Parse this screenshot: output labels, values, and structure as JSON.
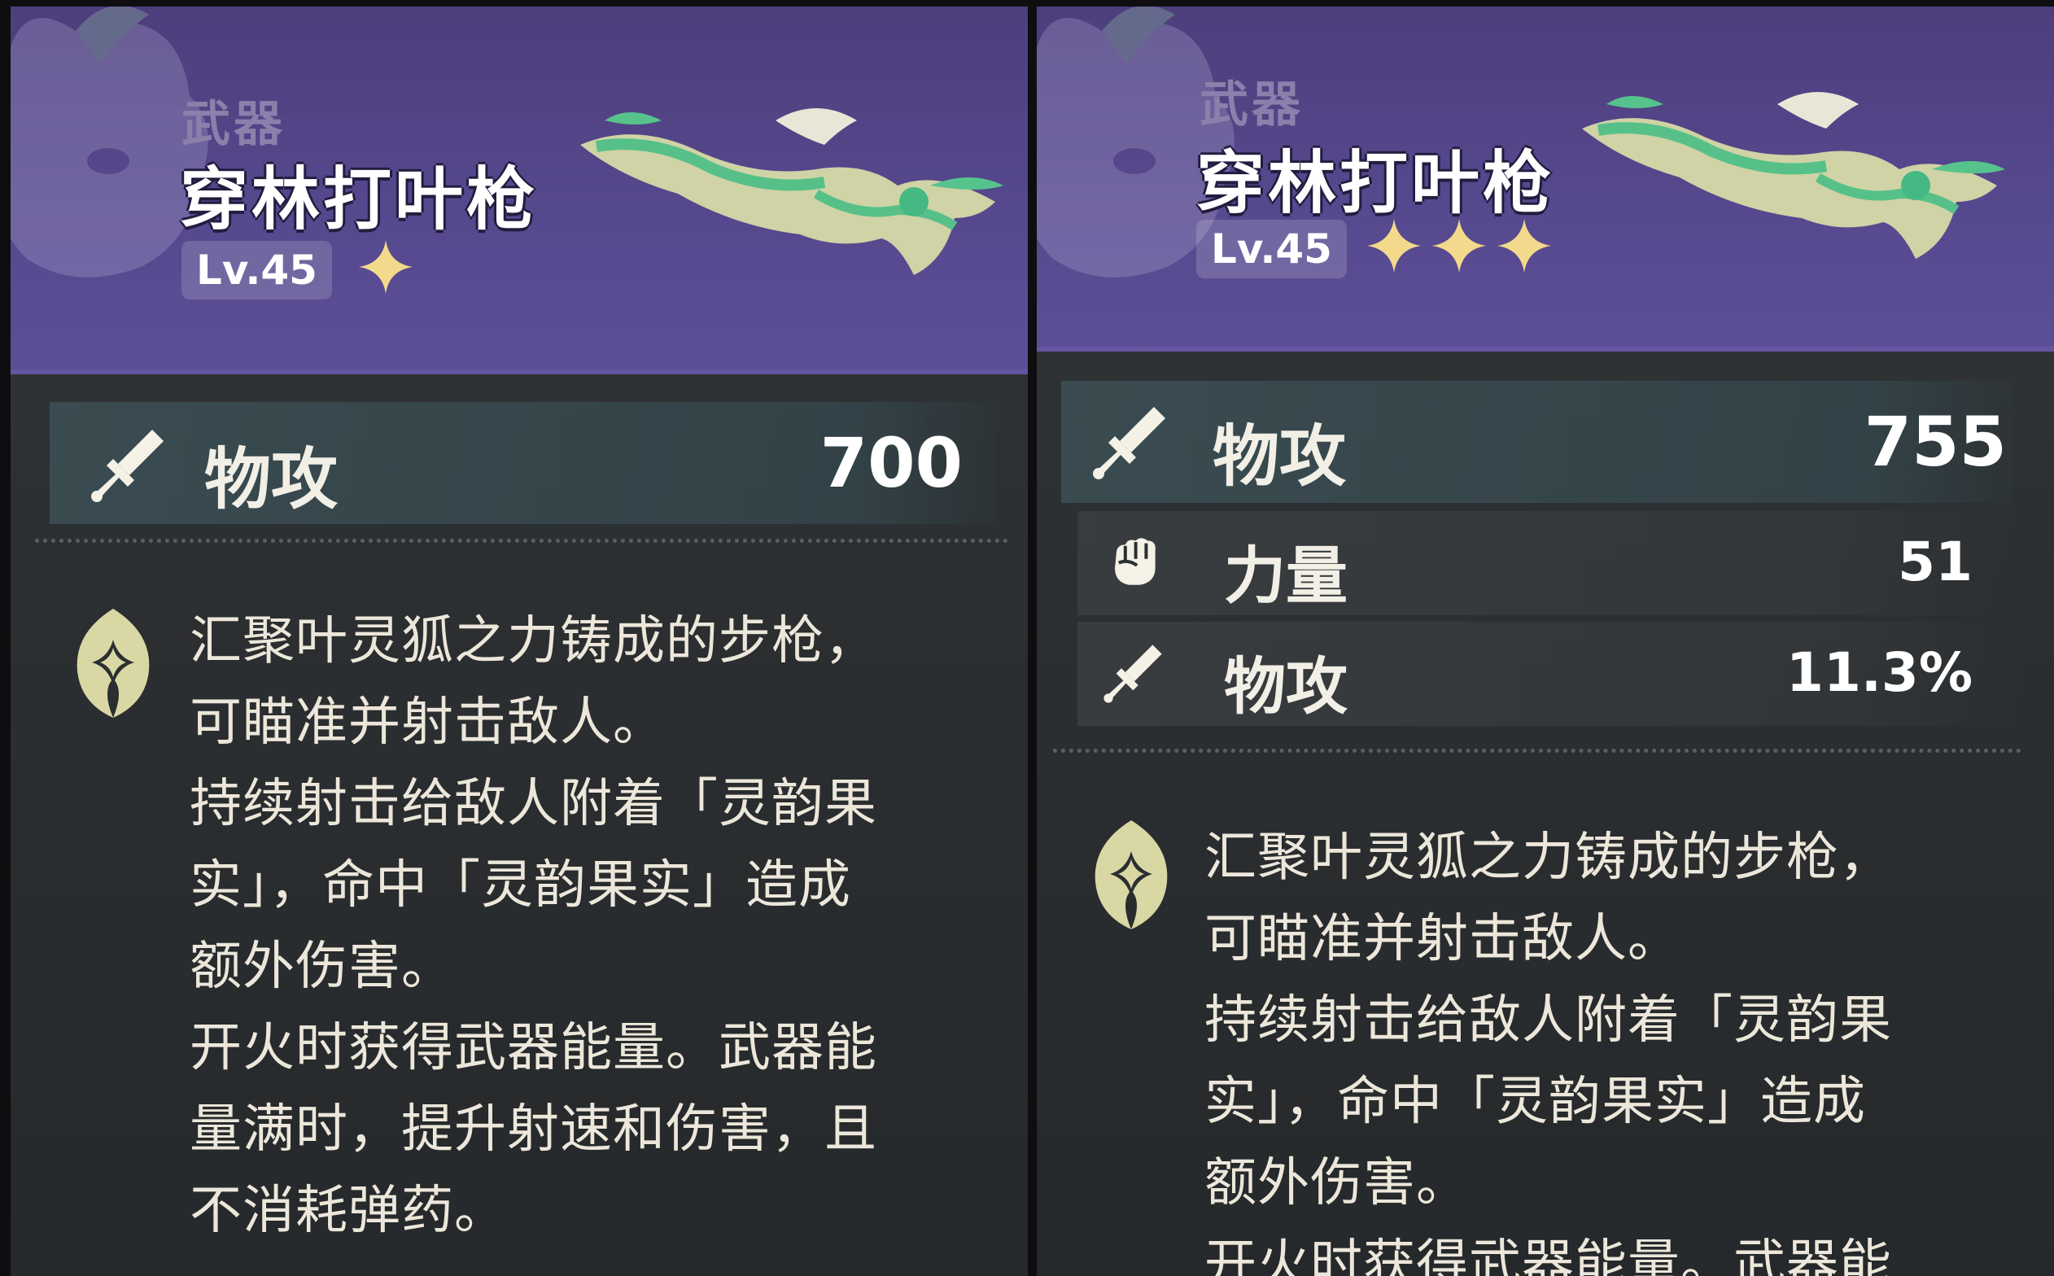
{
  "cards": [
    {
      "category": "武器",
      "name": "穿林打叶枪",
      "level": "Lv.45",
      "stars": 1,
      "main_stat": {
        "icon": "sword-icon",
        "label": "物攻",
        "value": "700"
      },
      "sub_stats": [],
      "description": [
        "汇聚叶灵狐之力铸成的步枪，",
        "可瞄准并射击敌人。",
        "持续射击给敌人附着「灵韵果",
        "实」，命中「灵韵果实」造成",
        "额外伤害。",
        "开火时获得武器能量。武器能",
        "量满时，提升射速和伤害，且",
        "不消耗弹药。"
      ]
    },
    {
      "category": "武器",
      "name": "穿林打叶枪",
      "level": "Lv.45",
      "stars": 3,
      "main_stat": {
        "icon": "sword-icon",
        "label": "物攻",
        "value": "755"
      },
      "sub_stats": [
        {
          "icon": "fist-icon",
          "label": "力量",
          "value": "51"
        },
        {
          "icon": "sword-icon",
          "label": "物攻",
          "value": "11.3%"
        }
      ],
      "description": [
        "汇聚叶灵狐之力铸成的步枪，",
        "可瞄准并射击敌人。",
        "持续射击给敌人附着「灵韵果",
        "实」，命中「灵韵果实」造成",
        "额外伤害。",
        "开火时获得武器能量。武器能"
      ]
    }
  ],
  "colors": {
    "header_purple": "#56488d",
    "star_gold": "#f3d98b",
    "body_dark": "#2c2f31",
    "stat_highlight": "#3c5056"
  }
}
